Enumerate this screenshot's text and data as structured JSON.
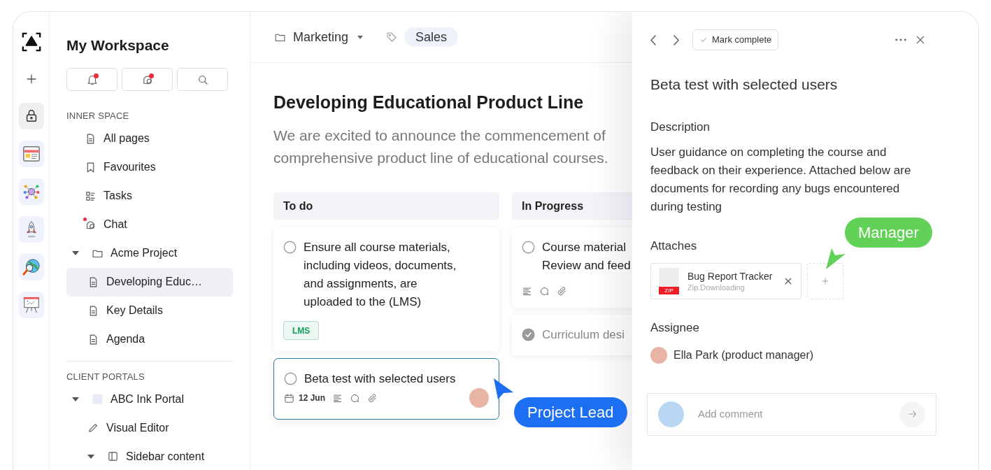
{
  "rail": {
    "items": [
      {
        "kind": "lock",
        "selected": true
      },
      {
        "kind": "browser",
        "selected": false
      },
      {
        "kind": "network",
        "selected": false
      },
      {
        "kind": "rocket",
        "selected": false
      },
      {
        "kind": "globe",
        "selected": false
      },
      {
        "kind": "board",
        "selected": false
      }
    ]
  },
  "sidebar": {
    "title": "My Workspace",
    "actions": [
      {
        "kind": "bell",
        "unread": true
      },
      {
        "kind": "chat",
        "unread": true
      },
      {
        "kind": "search",
        "unread": false
      }
    ],
    "sections": [
      {
        "title": "INNER SPACE",
        "items": [
          {
            "kind": "page",
            "label": "All pages",
            "unread": false,
            "selected": false
          },
          {
            "kind": "bookmark",
            "label": "Favourites",
            "unread": false,
            "selected": false
          },
          {
            "kind": "tasks",
            "label": "Tasks",
            "unread": false,
            "selected": false
          },
          {
            "kind": "chat",
            "label": "Chat",
            "unread": true,
            "selected": false
          },
          {
            "kind": "folder",
            "label": "Acme Project",
            "unread": false,
            "selected": false,
            "expanded": true,
            "children": [
              {
                "kind": "page",
                "label": "Developing Educ…",
                "unread": false,
                "selected": true
              },
              {
                "kind": "page",
                "label": "Key Details",
                "unread": false,
                "selected": false
              },
              {
                "kind": "page",
                "label": "Agenda",
                "unread": false,
                "selected": false
              }
            ]
          }
        ]
      },
      {
        "title": "CLIENT PORTALS",
        "items": [
          {
            "kind": "square",
            "label": "ABC Ink Portal",
            "unread": false,
            "selected": false,
            "expanded": true,
            "children": [
              {
                "kind": "pencil",
                "label": "Visual Editor",
                "unread": false,
                "selected": false
              },
              {
                "kind": "layout",
                "label": "Sidebar content",
                "unread": false,
                "selected": false,
                "expanded": true
              }
            ]
          }
        ]
      }
    ]
  },
  "main": {
    "folder": "Marketing",
    "tag": "Sales",
    "title": "Developing Educational Product Line",
    "description_lines": [
      "We are excited to announce the commencement of",
      "comprehensive product line of educational courses."
    ],
    "columns": [
      {
        "title": "To do",
        "cards": [
          {
            "lines": [
              "Ensure all course materials,",
              "including videos, documents,",
              "and assignments, are",
              "uploaded to the (LMS)"
            ],
            "done": false,
            "selected": false,
            "meta": false,
            "avatar": false,
            "tags": [
              {
                "label": "LMS",
                "color": "#0f9d58"
              }
            ]
          },
          {
            "lines": [
              "Beta test with selected users"
            ],
            "done": false,
            "selected": true,
            "date": "12 Jun",
            "meta": true,
            "avatar": true
          }
        ]
      },
      {
        "title": "In Progress",
        "cards": [
          {
            "lines": [
              "Course material",
              "Review and feed"
            ],
            "done": false,
            "selected": false,
            "meta": true,
            "avatar": false
          },
          {
            "lines": [
              "Curriculum desi"
            ],
            "done": true,
            "selected": false,
            "meta": false,
            "avatar": false
          }
        ]
      }
    ]
  },
  "detail": {
    "action": "Mark complete",
    "title": "Beta test with selected users",
    "description_label": "Description",
    "description": "User guidance on completing the course and feedback on their experience. Attached below are documents for recording any bugs encountered during testing",
    "attachments_label": "Attaches",
    "attachments": [
      {
        "name": "Bug Report Tracker",
        "status": "Zip.Downloading",
        "type": "ZIP"
      }
    ],
    "assignee_label": "Assignee",
    "assignee": "Ella Park (product manager)",
    "comment": {
      "placeholder": "Add comment"
    }
  },
  "annotations": [
    {
      "label": "Project Lead",
      "color": "#1d6ff2",
      "kind": "cursor"
    },
    {
      "label": "Manager",
      "color": "#62d157",
      "kind": "arrow"
    }
  ]
}
